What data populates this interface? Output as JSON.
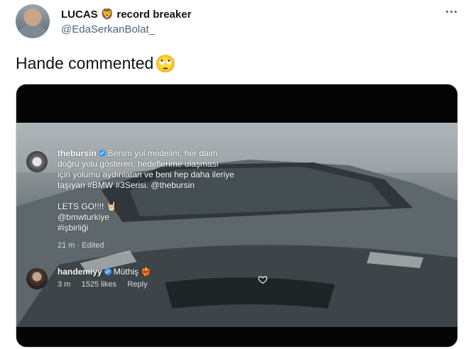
{
  "author": {
    "display_name": "LUCAS",
    "name_emoji": "🦁",
    "name_suffix": "record breaker",
    "handle": "@EdaSerkanBolat_"
  },
  "tweet": {
    "text": "Hande commented",
    "emoji": "🙄"
  },
  "media": {
    "comment1": {
      "username": "thebursin",
      "lines": [
        "Benim yol modelim; her daim",
        "doğru yolu gösteren, hedeflerime ulaşması",
        "için yolumu aydınlatan ve beni hep daha ileriye",
        "taşıyan #BMW #3Serisi. @thebursin"
      ],
      "extra_lines": [
        "LETS GO!!!! 🤘🏻",
        "@bmwturkiye",
        "#işbirliği"
      ],
      "time": "21 m",
      "edited": "Edited"
    },
    "comment2": {
      "username": "handemiyy",
      "text": "Müthiş",
      "emoji": "❤️‍🔥",
      "time": "3 m",
      "likes": "1525 likes",
      "reply": "Reply"
    }
  },
  "colors": {
    "verified": "#3897f0",
    "handle": "#536471"
  }
}
